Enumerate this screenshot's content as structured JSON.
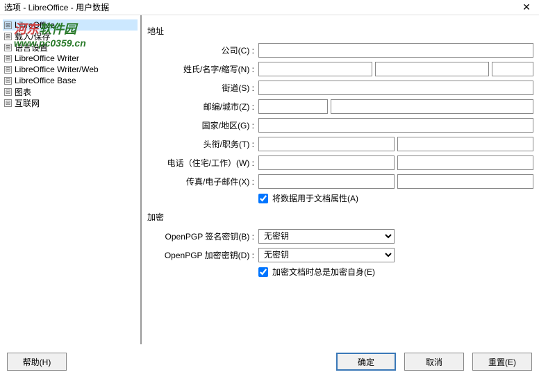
{
  "titlebar": {
    "title": "选项 - LibreOffice - 用户数据"
  },
  "watermark": {
    "line1a": "河东",
    "line1b": "软件园",
    "line2": "www.pc0359.cn"
  },
  "sidebar": {
    "items": [
      {
        "label": "LibreOffice",
        "selected": true,
        "expanded": false
      },
      {
        "label": "载入/保存"
      },
      {
        "label": "语言设置"
      },
      {
        "label": "LibreOffice Writer"
      },
      {
        "label": "LibreOffice Writer/Web"
      },
      {
        "label": "LibreOffice Base"
      },
      {
        "label": "图表"
      },
      {
        "label": "互联网"
      }
    ]
  },
  "content": {
    "address_group": "地址",
    "labels": {
      "company": "公司(C) :",
      "name": "姓氏/名字/缩写(N) :",
      "street": "街道(S) :",
      "zipcity": "邮编/城市(Z) :",
      "country": "国家/地区(G) :",
      "title": "头衔/职务(T) :",
      "phone": "电话（住宅/工作）(W) :",
      "fax": "传真/电子邮件(X) :"
    },
    "use_for_doc": {
      "label": "将数据用于文档属性(A)",
      "checked": true
    },
    "encrypt_group": "加密",
    "pgp_sign_label": "OpenPGP 签名密钥(B) :",
    "pgp_encrypt_label": "OpenPGP 加密密钥(D) :",
    "pgp_options": [
      "无密钥"
    ],
    "pgp_sign_value": "无密钥",
    "pgp_encrypt_value": "无密钥",
    "encrypt_self": {
      "label": "加密文档时总是加密自身(E)",
      "checked": true
    }
  },
  "footer": {
    "help": "帮助(H)",
    "ok": "确定",
    "cancel": "取消",
    "reset": "重置(E)"
  }
}
